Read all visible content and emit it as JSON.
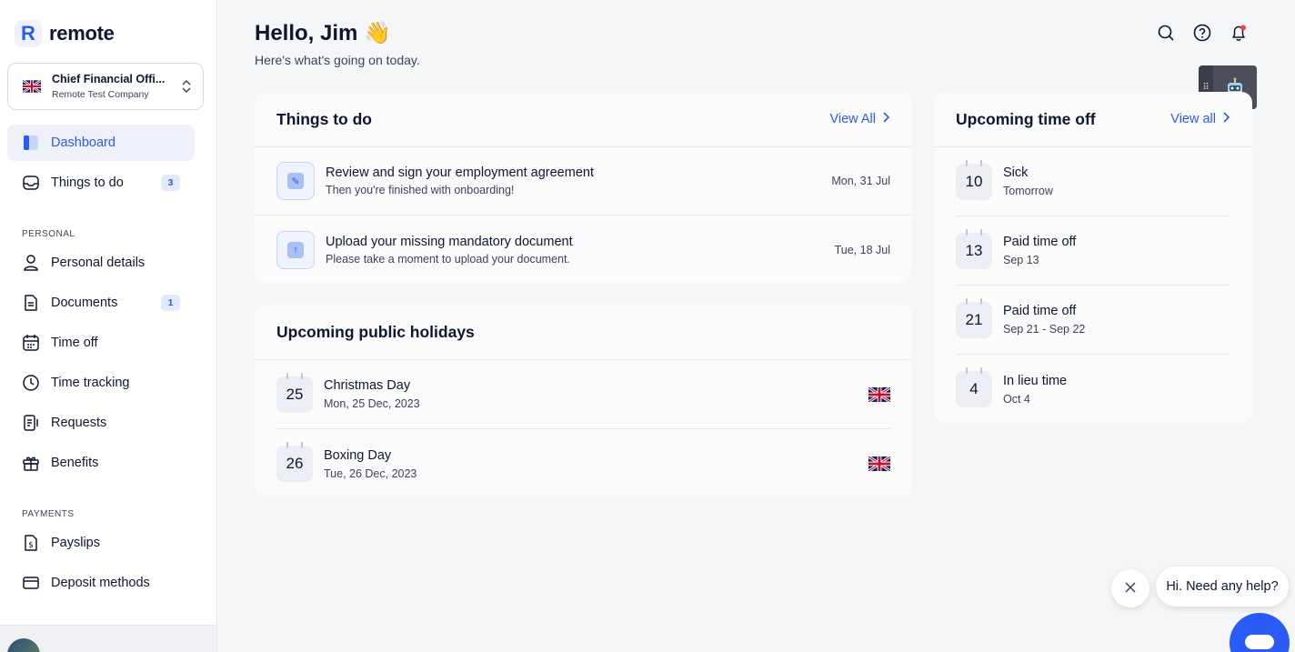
{
  "brand": {
    "name": "remote",
    "mark": "R"
  },
  "account": {
    "role": "Chief Financial Offi...",
    "company": "Remote Test Company"
  },
  "nav": {
    "dashboard": "Dashboard",
    "things_to_do": "Things to do",
    "things_to_do_count": "3",
    "personal_label": "PERSONAL",
    "personal_details": "Personal details",
    "documents": "Documents",
    "documents_count": "1",
    "time_off": "Time off",
    "time_tracking": "Time tracking",
    "requests": "Requests",
    "benefits": "Benefits",
    "payments_label": "PAYMENTS",
    "payslips": "Payslips",
    "deposit_methods": "Deposit methods"
  },
  "header": {
    "greeting": "Hello, Jim 👋",
    "subtitle": "Here's what's going on today."
  },
  "todo": {
    "title": "Things to do",
    "view_all": "View All",
    "items": [
      {
        "title": "Review and sign your employment agreement",
        "subtitle": "Then you're finished with onboarding!",
        "date": "Mon, 31 Jul",
        "icon": "pen-icon"
      },
      {
        "title": "Upload your missing mandatory document",
        "subtitle": "Please take a moment to upload your document.",
        "date": "Tue, 18 Jul",
        "icon": "upload-icon"
      }
    ]
  },
  "holidays": {
    "title": "Upcoming public holidays",
    "items": [
      {
        "day": "25",
        "name": "Christmas Day",
        "date": "Mon, 25 Dec, 2023"
      },
      {
        "day": "26",
        "name": "Boxing Day",
        "date": "Tue, 26 Dec, 2023"
      }
    ]
  },
  "time_off": {
    "title": "Upcoming time off",
    "view_all": "View all",
    "items": [
      {
        "day": "10",
        "type": "Sick",
        "when": "Tomorrow"
      },
      {
        "day": "13",
        "type": "Paid time off",
        "when": "Sep 13"
      },
      {
        "day": "21",
        "type": "Paid time off",
        "when": "Sep 21 - Sep 22"
      },
      {
        "day": "4",
        "type": "In lieu time",
        "when": "Oct 4"
      }
    ]
  },
  "chat": {
    "prompt": "Hi. Need any help?"
  },
  "colors": {
    "accent": "#2b5bf6",
    "text": "#0f1730",
    "muted": "#3c4359",
    "background": "#f5f6f8"
  }
}
